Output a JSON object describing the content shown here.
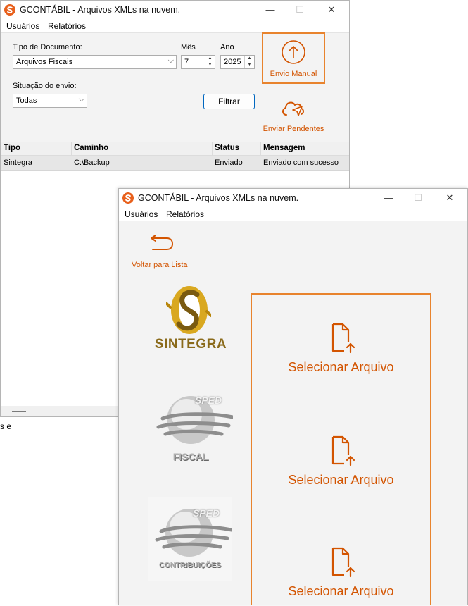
{
  "app": {
    "title": "GCONTÁBIL - Arquivos XMLs na nuvem."
  },
  "menu": {
    "items": [
      "Usuários",
      "Relatórios"
    ]
  },
  "filters": {
    "tipo_label": "Tipo de Documento:",
    "tipo_value": "Arquivos Fiscais",
    "mes_label": "Mês",
    "mes_value": "7",
    "ano_label": "Ano",
    "ano_value": "2025",
    "situacao_label": "Situação do envio:",
    "situacao_value": "Todas",
    "filtrar_label": "Filtrar"
  },
  "actions": {
    "envio_manual": "Envio Manual",
    "enviar_pendentes": "Enviar Pendentes"
  },
  "table": {
    "headers": [
      "Tipo",
      "Caminho",
      "Status",
      "Mensagem"
    ],
    "rows": [
      [
        "Sintegra",
        "C:\\Backup",
        "Enviado",
        "Enviado com sucesso"
      ]
    ]
  },
  "manual": {
    "voltar_label": "Voltar para Lista",
    "items": [
      {
        "brand": "SINTEGRA",
        "button": "Selecionar Arquivo"
      },
      {
        "brand_top": "SPED",
        "brand": "FISCAL",
        "button": "Selecionar Arquivo"
      },
      {
        "brand_top": "SPED",
        "brand": "CONTRIBUIÇÕES",
        "button": "Selecionar Arquivo"
      }
    ]
  },
  "fragment_text": "s e",
  "colors": {
    "accent": "#d35400",
    "accent_border": "#e8832d",
    "filter_border": "#0067c0",
    "sintegra_gold": "#b8860b"
  },
  "icons": {
    "logo": "gcontabil-logo-icon",
    "upload_circle": "upload-circle-icon",
    "cloud_send": "cloud-send-icon",
    "back": "back-arrow-icon",
    "file_upload": "file-upload-icon"
  }
}
